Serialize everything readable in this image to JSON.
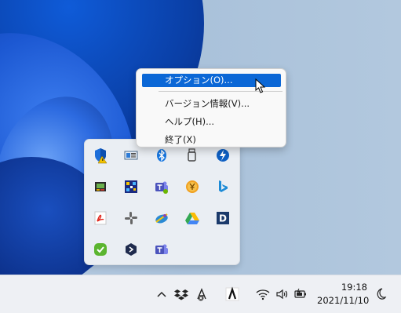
{
  "context_menu": {
    "items": [
      {
        "label": "オプション(O)...",
        "highlighted": true
      },
      {
        "label": "バージョン情報(V)..."
      },
      {
        "label": "ヘルプ(H)..."
      },
      {
        "label": "終了(X)"
      }
    ]
  },
  "overflow_tray": {
    "icons": [
      "defender-warning-icon",
      "display-adapter-icon",
      "bluetooth-icon",
      "usb-drive-icon",
      "rapid-storage-icon",
      "dell-icon",
      "qr-app-icon",
      "teams-icon",
      "clock-coin-icon",
      "bing-icon",
      "acrobat-icon",
      "slack-icon",
      "meet-now-icon",
      "google-drive-icon",
      "d-app-icon",
      "green-check-icon",
      "hex-app-icon",
      "teams-personal-icon"
    ]
  },
  "taskbar": {
    "time": "19:18",
    "date": "2021/11/10",
    "icons": [
      "chevron-up-icon",
      "dropbox-icon",
      "a-sync-icon",
      "a-app-icon",
      "wifi-icon",
      "volume-icon",
      "battery-icon",
      "moon-icon"
    ]
  },
  "colors": {
    "accent": "#0b67d6",
    "wallpaper_blue": "#0f5bd8",
    "menu_bg": "#f9f9f9",
    "taskbar_bg": "#eef0f4"
  }
}
